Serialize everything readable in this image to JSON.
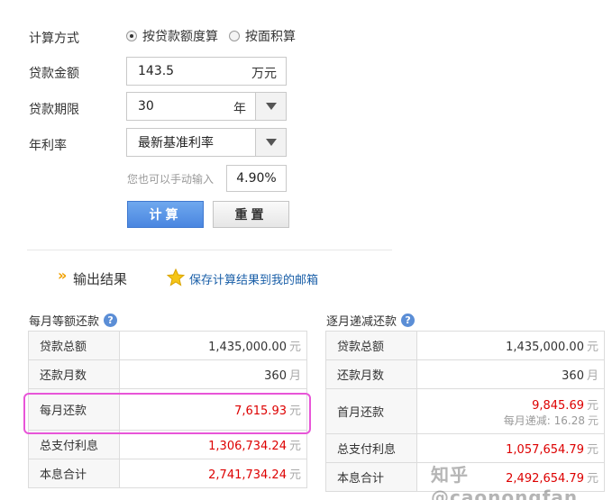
{
  "form": {
    "calc_method_label": "计算方式",
    "calc_options": [
      "按贷款额度算",
      "按面积算"
    ],
    "loan_amount_label": "贷款金额",
    "loan_amount_value": "143.5",
    "loan_amount_unit": "万元",
    "loan_term_label": "贷款期限",
    "loan_term_value": "30",
    "loan_term_unit": "年",
    "rate_label": "年利率",
    "rate_select_value": "最新基准利率",
    "manual_hint": "您也可以手动输入",
    "rate_value": "4.90%",
    "calc_button": "计算",
    "reset_button": "重置"
  },
  "output": {
    "title": "输出结果",
    "save_link": "保存计算结果到我的邮箱"
  },
  "equal_payment": {
    "title": "每月等额还款",
    "rows": [
      {
        "key": "贷款总额",
        "value": "1,435,000.00",
        "unit": "元"
      },
      {
        "key": "还款月数",
        "value": "360",
        "unit": "月"
      },
      {
        "key": "每月还款",
        "value": "7,615.93",
        "unit": "元"
      },
      {
        "key": "总支付利息",
        "value": "1,306,734.24",
        "unit": "元"
      },
      {
        "key": "本息合计",
        "value": "2,741,734.24",
        "unit": "元"
      }
    ]
  },
  "decreasing_payment": {
    "title": "逐月递减还款",
    "rows": [
      {
        "key": "贷款总额",
        "value": "1,435,000.00",
        "unit": "元"
      },
      {
        "key": "还款月数",
        "value": "360",
        "unit": "月"
      },
      {
        "key": "首月还款",
        "value": "9,845.69",
        "unit": "元",
        "sub_label": "每月递减:",
        "sub_value": "16.28",
        "sub_unit": "元"
      },
      {
        "key": "总支付利息",
        "value": "1,057,654.79",
        "unit": "元"
      },
      {
        "key": "本息合计",
        "value": "2,492,654.79",
        "unit": "元"
      }
    ]
  },
  "watermark": "知乎 @caonongfan",
  "colors": {
    "calc_button": "#4a86e0",
    "highlight_border": "#e855d8",
    "value_red": "#dd0000",
    "link_blue": "#1a5fa8"
  }
}
